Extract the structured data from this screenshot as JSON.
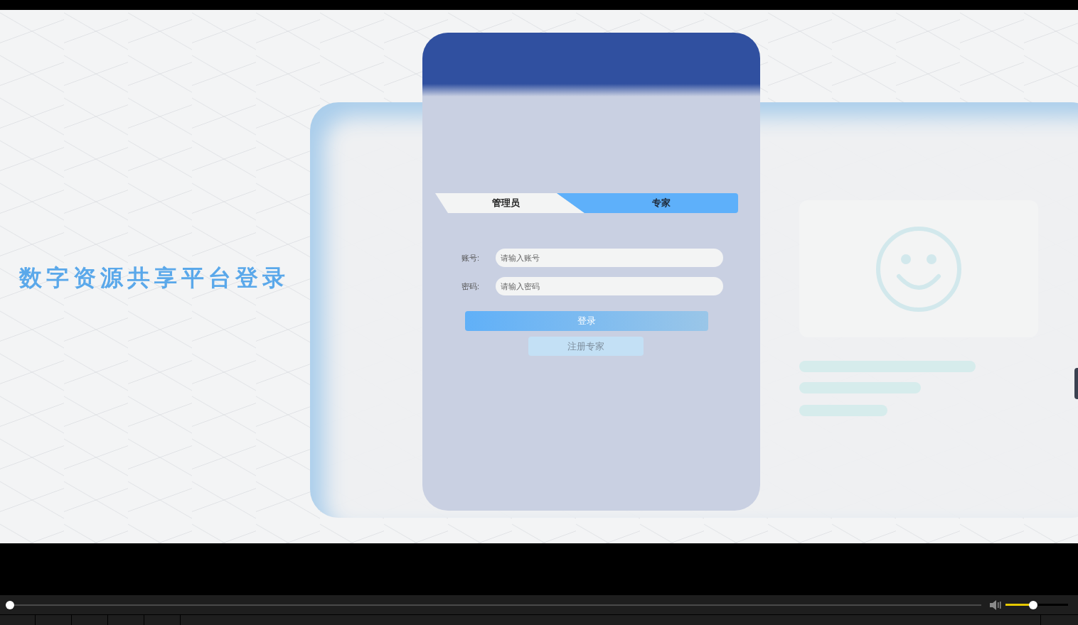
{
  "page_title": "数字资源共享平台登录",
  "tabs": [
    {
      "label": "管理员",
      "selected": false
    },
    {
      "label": "专家",
      "selected": true
    }
  ],
  "fields": [
    {
      "label": "账号:",
      "placeholder": "请输入账号"
    },
    {
      "label": "密码:",
      "placeholder": "请输入密码"
    }
  ],
  "login_button": "登录",
  "register_button": "注册专家",
  "player": {
    "seek": {
      "level": 0.0
    },
    "volume": {
      "level": 0.44
    }
  }
}
